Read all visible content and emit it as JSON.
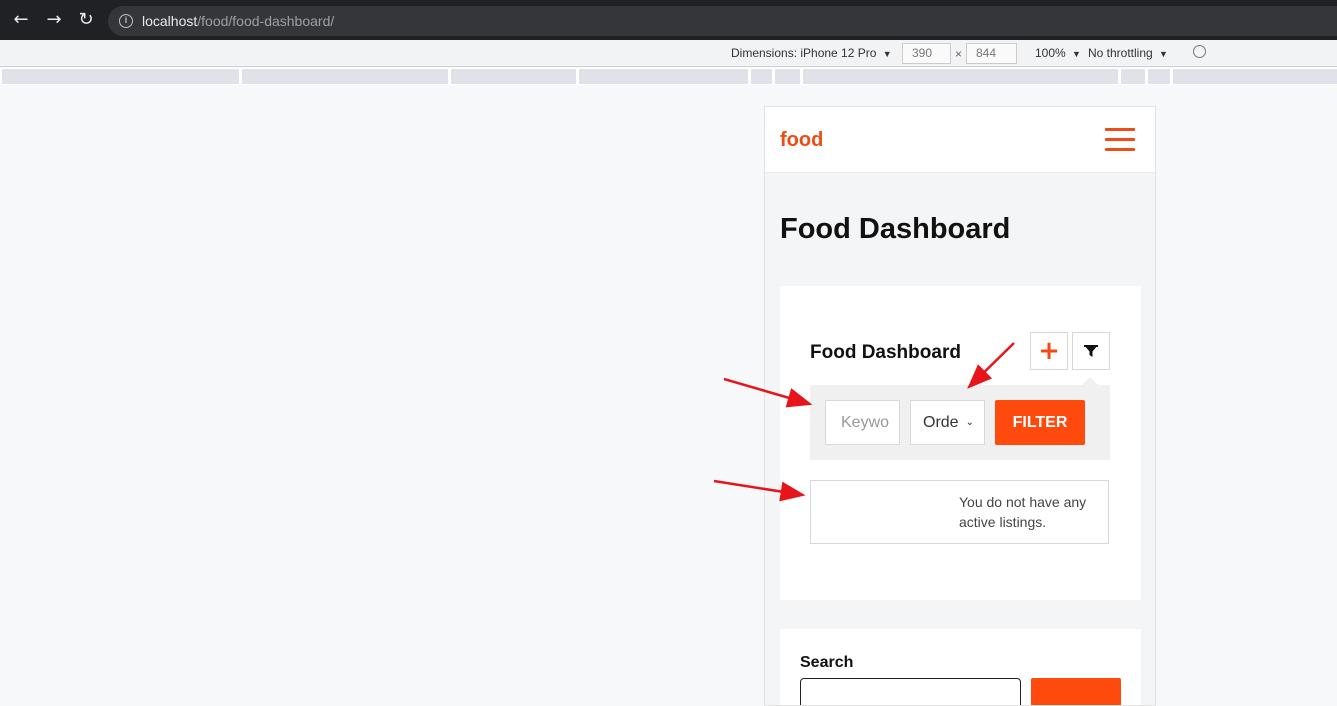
{
  "browser": {
    "url_host": "localhost",
    "url_path": "/food/food-dashboard/"
  },
  "devtools": {
    "dimensions_label": "Dimensions: iPhone 12 Pro",
    "width": "390",
    "times": "×",
    "height": "844",
    "zoom": "100%",
    "throttling": "No throttling",
    "caret": "▼"
  },
  "site": {
    "logo": "food",
    "accent_color": "#f04b14"
  },
  "main": {
    "page_title": "Food Dashboard",
    "dashboard": {
      "title": "Food Dashboard",
      "keyword_placeholder": "Keywo",
      "order_value": "Orde",
      "filter_button": "FILTER",
      "empty_message": "You do not have any active listings."
    },
    "search": {
      "label": "Search"
    }
  }
}
